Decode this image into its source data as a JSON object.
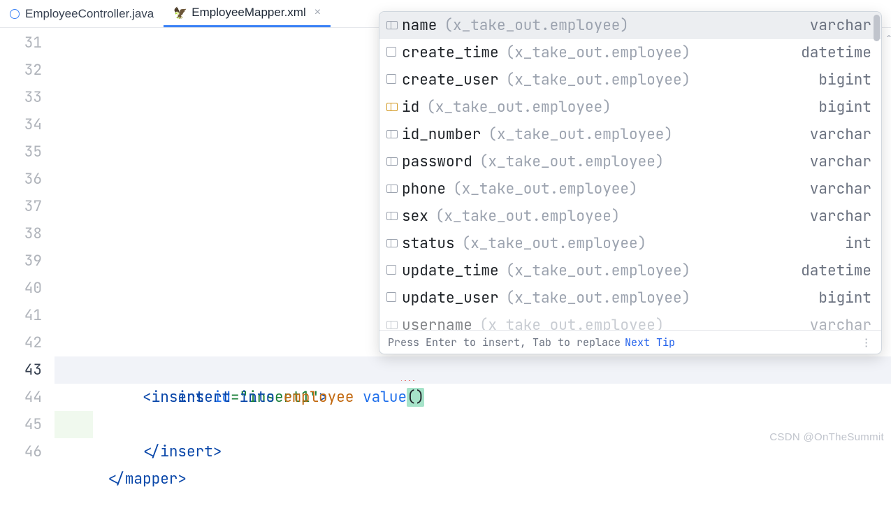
{
  "tabs": [
    {
      "label": "EmployeeController.java",
      "active": false,
      "closable": false,
      "icon": "java"
    },
    {
      "label": "EmployeeMapper.xml",
      "active": true,
      "closable": true,
      "icon": "xml"
    }
  ],
  "lines": {
    "start": 31,
    "current": 43,
    "end": 46
  },
  "code": {
    "l42": {
      "open": "<",
      "tag": "insert",
      "sp": " ",
      "attr": "id",
      "eq": "=",
      "val": "\"insert1\"",
      "close": ">"
    },
    "l43": {
      "kw1": "insert",
      "sp1": " ",
      "kw2": "into",
      "sp2": " ",
      "tbl": "employee",
      "sp3": " ",
      "fn": "value",
      "paren": "()"
    },
    "l44": {
      "open": "</",
      "tag": "insert",
      "close": ">"
    },
    "l46": {
      "open": "</",
      "tag": "mapper",
      "close": ">"
    }
  },
  "popup": {
    "items": [
      {
        "icon": "col",
        "name": "name",
        "ns": "(x_take_out.employee)",
        "type": "varchar",
        "selected": true
      },
      {
        "icon": "box",
        "name": "create_time",
        "ns": "(x_take_out.employee)",
        "type": "datetime"
      },
      {
        "icon": "box",
        "name": "create_user",
        "ns": "(x_take_out.employee)",
        "type": "bigint"
      },
      {
        "icon": "pk",
        "name": "id",
        "ns": "(x_take_out.employee)",
        "type": "bigint"
      },
      {
        "icon": "col",
        "name": "id_number",
        "ns": "(x_take_out.employee)",
        "type": "varchar"
      },
      {
        "icon": "col",
        "name": "password",
        "ns": "(x_take_out.employee)",
        "type": "varchar"
      },
      {
        "icon": "col",
        "name": "phone",
        "ns": "(x_take_out.employee)",
        "type": "varchar"
      },
      {
        "icon": "col",
        "name": "sex",
        "ns": "(x_take_out.employee)",
        "type": "varchar"
      },
      {
        "icon": "col",
        "name": "status",
        "ns": "(x_take_out.employee)",
        "type": "int"
      },
      {
        "icon": "box",
        "name": "update_time",
        "ns": "(x_take_out.employee)",
        "type": "datetime"
      },
      {
        "icon": "box",
        "name": "update_user",
        "ns": "(x_take_out.employee)",
        "type": "bigint"
      },
      {
        "icon": "col",
        "name": "username",
        "ns": "(x_take_out.employee)",
        "type": "varchar",
        "cut": true
      }
    ],
    "footerHint": "Press Enter to insert, Tab to replace",
    "footerLink": "Next Tip"
  },
  "watermark": "CSDN @OnTheSummit"
}
